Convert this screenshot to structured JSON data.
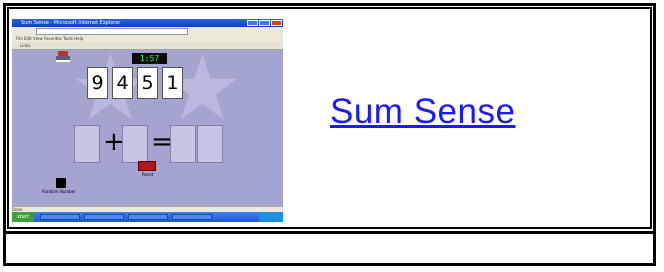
{
  "thumbnail": {
    "window_title": "Sum Sense - Microsoft Internet Explorer",
    "menu": "File  Edit  View  Favorites  Tools  Help",
    "links_bar": "Links",
    "timer": "1:57",
    "digits": [
      "9",
      "4",
      "5",
      "1"
    ],
    "plus": "+",
    "equals": "=",
    "left_button_label": "Random Number",
    "reset_label": "Reset",
    "status": "Done",
    "start_label": "start"
  },
  "link": {
    "text": "Sum Sense"
  },
  "colors": {
    "link": "#1a1aff",
    "stage": "#a4a4d0",
    "timer_text": "#36ff46"
  }
}
